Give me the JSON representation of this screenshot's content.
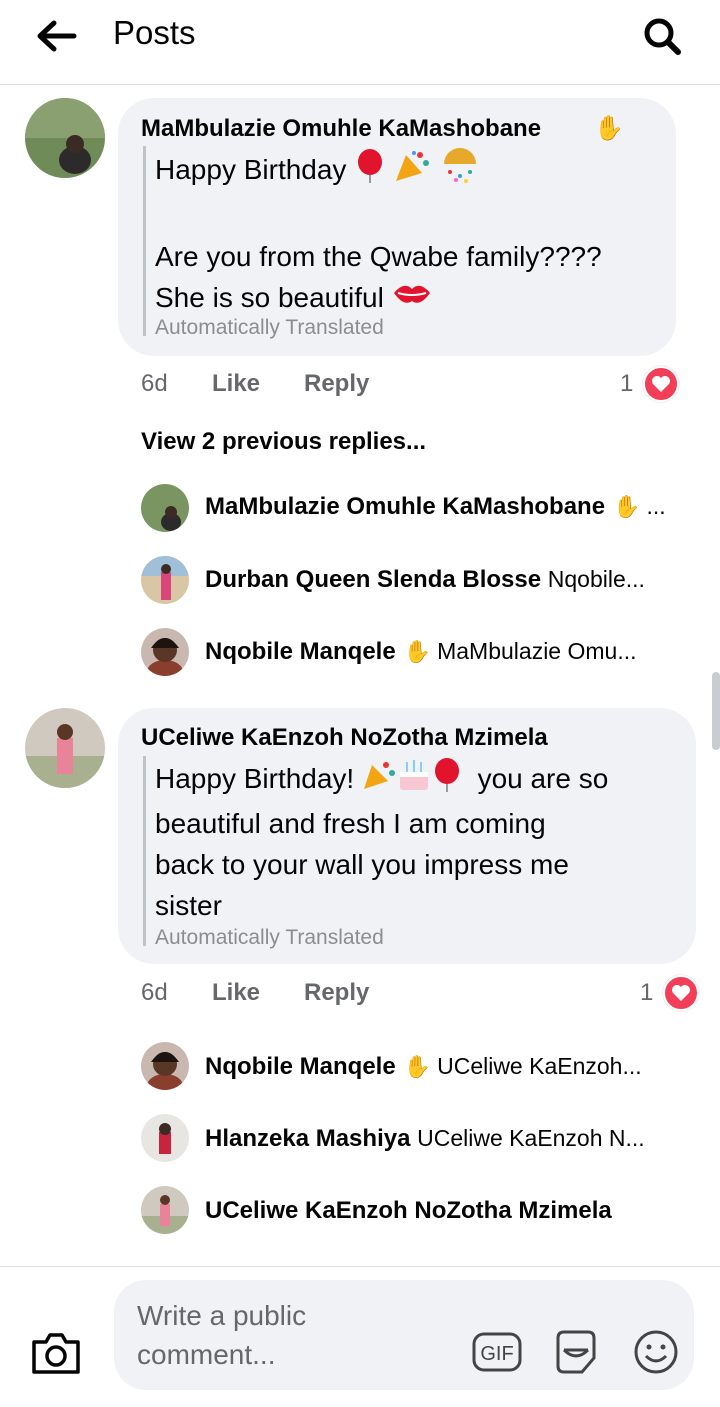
{
  "header": {
    "title": "Posts",
    "back_icon": "arrow-left-icon",
    "search_icon": "search-icon"
  },
  "comments": [
    {
      "author": "MaMbulazie Omuhle KaMashobane",
      "line1": "Happy Birthday",
      "line2": "Are you from the Qwabe family????",
      "line3": "She is so beautiful",
      "translated": "Automatically Translated",
      "time": "6d",
      "like": "Like",
      "reply": "Reply",
      "reaction_count": "1",
      "view_previous": "View 2 previous replies...",
      "replies": [
        {
          "name": "MaMbulazie Omuhle KaMashobane",
          "snippet": "..."
        },
        {
          "name": "Durban Queen Slenda Blosse",
          "snippet": "Nqobile..."
        },
        {
          "name": "Nqobile Manqele",
          "snippet": "MaMbulazie Omu..."
        }
      ]
    },
    {
      "author": "UCeliwe KaEnzoh NoZotha Mzimela",
      "line1a": "Happy Birthday!",
      "line1b": "you are so",
      "line2": "beautiful and fresh I am coming",
      "line3": "back to your wall you impress me",
      "line4": "sister",
      "translated": "Automatically Translated",
      "time": "6d",
      "like": "Like",
      "reply": "Reply",
      "reaction_count": "1",
      "replies": [
        {
          "name": "Nqobile Manqele",
          "snippet": "UCeliwe KaEnzoh..."
        },
        {
          "name": "Hlanzeka Mashiya",
          "snippet": "UCeliwe KaEnzoh N..."
        },
        {
          "name": "UCeliwe KaEnzoh NoZotha Mzimela",
          "snippet": ""
        }
      ]
    }
  ],
  "composer": {
    "placeholder_line1": "Write a public",
    "placeholder_line2": "comment...",
    "gif_label": "GIF",
    "camera_icon": "camera-icon",
    "sticker_icon": "sticker-icon",
    "emoji_icon": "smiley-emoji-icon"
  },
  "colors": {
    "bubble": "#f0f2f5",
    "secondary_text": "#65676b",
    "heart_red": "#f33e58",
    "divider": "#dadde1"
  }
}
